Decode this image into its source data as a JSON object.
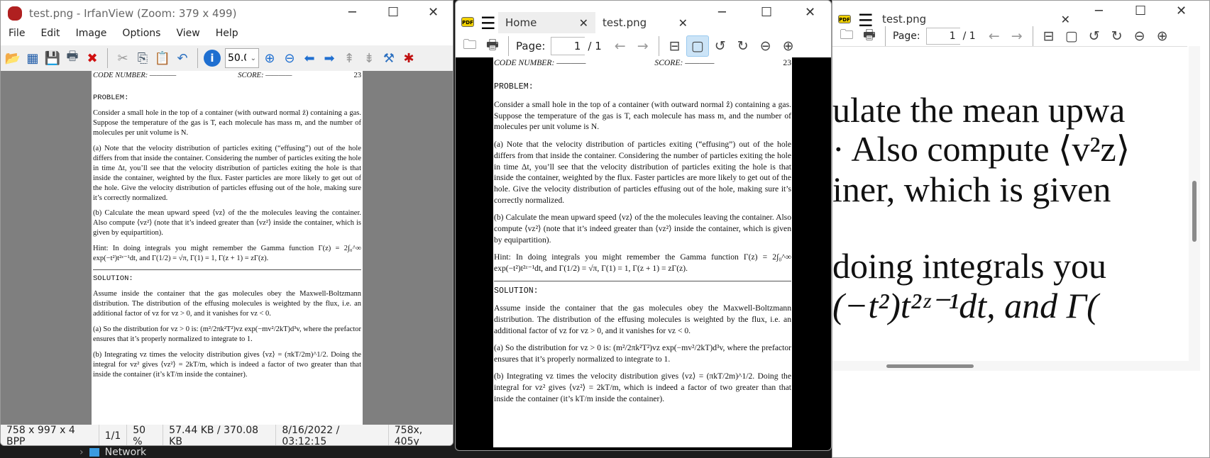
{
  "irfan": {
    "title": "test.png - IrfanView (Zoom: 379 x 499)",
    "menu": [
      "File",
      "Edit",
      "Image",
      "Options",
      "View",
      "Help"
    ],
    "zoom_value": "50.0",
    "status": [
      "758 x 997 x 4 BPP",
      "1/1",
      "50 %",
      "57.44 KB / 370.08 KB",
      "8/16/2022 / 03:12:15",
      "758x, 405y"
    ]
  },
  "taskbar": {
    "network_label": "Network"
  },
  "sumatra": {
    "tabs": [
      {
        "label": "Home"
      },
      {
        "label": "test.png"
      }
    ],
    "page_label": "Page:",
    "page_value": "1",
    "page_total": "/ 1"
  },
  "sumatra2": {
    "tab": "test.png",
    "page_label": "Page:",
    "page_value": "1",
    "page_total": "/ 1",
    "zoomed_lines": [
      "ulate the mean upwa",
      "·  Also compute ⟨v²z⟩",
      "iner, which is given",
      "doing integrals you",
      "(−t²)t²ᶻ⁻¹dt, and Γ("
    ]
  },
  "document": {
    "code_number": "CODE NUMBER: ————",
    "score": "SCORE: ————",
    "page_number": "23",
    "problem_heading": "PROBLEM:",
    "problem": [
      "Consider a small hole in the top of a container (with outward normal ẑ) containing a gas. Suppose the temperature of the gas is T, each molecule has mass m, and the number of molecules per unit volume is N.",
      "(a) Note that the velocity distribution of particles exiting (“effusing”) out of the hole differs from that inside the container. Considering the number of particles exiting the hole in time Δt, you’ll see that the velocity distribution of particles exiting the hole is that inside the container, weighted by the flux. Faster particles are more likely to get out of the hole. Give the velocity distribution of particles effusing out of the hole, making sure it’s correctly normalized.",
      "(b) Calculate the mean upward speed ⟨vz⟩ of the the molecules leaving the container. Also compute ⟨vz²⟩ (note that it’s indeed greater than ⟨vz²⟩ inside the container, which is given by equipartition).",
      "Hint: In doing integrals you might remember the Gamma function Γ(z) = 2∫₀^∞ exp(−t²)t²ᶻ⁻¹dt, and Γ(1/2) = √π, Γ(1) = 1, Γ(z + 1) = zΓ(z)."
    ],
    "solution_heading": "SOLUTION:",
    "solution": [
      "Assume inside the container that the gas molecules obey the Maxwell-Boltzmann distribution. The distribution of the effusing molecules is weighted by the flux, i.e. an additional factor of vz for vz > 0, and it vanishes for vz < 0.",
      "(a) So the distribution for vz > 0 is: (m²/2πk²T²)vz exp(−mv²/2kT)d³v, where the prefactor ensures that it’s properly normalized to integrate to 1.",
      "(b) Integrating vz times the velocity distribution gives ⟨vz⟩ = (πkT/2m)^1/2. Doing the integral for vz² gives ⟨vz²⟩ = 2kT/m, which is indeed a factor of two greater than that inside the container (it’s kT/m inside the container)."
    ]
  }
}
